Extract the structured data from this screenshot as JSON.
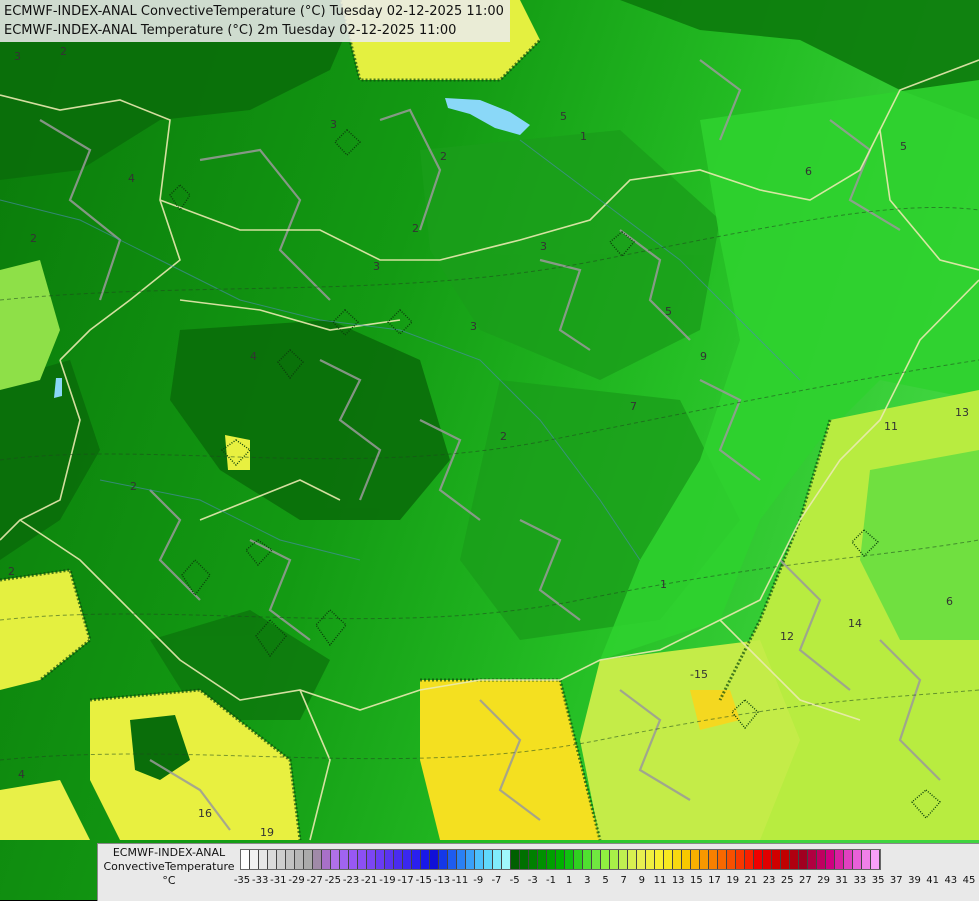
{
  "title": {
    "line1": "ECMWF-INDEX-ANAL ConvectiveTemperature (°C) Tuesday 02-12-2025 11:00",
    "line2": "ECMWF-INDEX-ANAL Temperature (°C) 2m Tuesday 02-12-2025 11:00"
  },
  "legend": {
    "line1": "ECMWF-INDEX-ANAL",
    "line2": "ConvectiveTemperature",
    "unit": "°C",
    "tick_labels": [
      "-35",
      "-33",
      "-31",
      "-29",
      "-27",
      "-25",
      "-23",
      "-21",
      "-19",
      "-17",
      "-15",
      "-13",
      "-11",
      "-9",
      "-7",
      "-5",
      "-3",
      "-1",
      "1",
      "3",
      "5",
      "7",
      "9",
      "11",
      "13",
      "15",
      "17",
      "19",
      "21",
      "23",
      "25",
      "27",
      "29",
      "31",
      "33",
      "35",
      "37",
      "39",
      "41",
      "43",
      "45"
    ],
    "colors": [
      "#ffffff",
      "#f2f2f2",
      "#e6e6e6",
      "#dadada",
      "#cecece",
      "#c2c2c2",
      "#b6b6b6",
      "#aaaaaa",
      "#a08aa8",
      "#a870c8",
      "#b070e8",
      "#a064f0",
      "#9858f4",
      "#8c50f4",
      "#7c46f4",
      "#6a3cf4",
      "#5a34f0",
      "#4a2cf0",
      "#3a28f0",
      "#2a20ee",
      "#1818e8",
      "#1010d8",
      "#1438e8",
      "#1e5cf0",
      "#2a80f4",
      "#3aa0f8",
      "#4cc0fc",
      "#60d8fc",
      "#80ecfc",
      "#a0f8fc",
      "#006000",
      "#007000",
      "#008000",
      "#009000",
      "#00a000",
      "#00b000",
      "#10c010",
      "#30d020",
      "#50e030",
      "#70e840",
      "#90f040",
      "#a8f048",
      "#c0f050",
      "#d8f050",
      "#e8f050",
      "#f0f040",
      "#f8f030",
      "#f8e820",
      "#f8d810",
      "#f8c800",
      "#f8b000",
      "#f89800",
      "#f88000",
      "#f86800",
      "#f85000",
      "#f83800",
      "#f82000",
      "#f00000",
      "#e00000",
      "#d00000",
      "#c00000",
      "#b00010",
      "#a00020",
      "#b00040",
      "#c00060",
      "#d00080",
      "#d820a0",
      "#e040c0",
      "#e860d8",
      "#f080e8",
      "#f8a0f8"
    ]
  },
  "map_labels": [
    "3",
    "2",
    "4",
    "2",
    "3",
    "2",
    "5",
    "6",
    "5",
    "3",
    "3",
    "1",
    "2",
    "2",
    "4",
    "2",
    "13",
    "11",
    "14",
    "-15",
    "16",
    "19",
    "6",
    "3",
    "4",
    "7",
    "9",
    "12",
    "2",
    "5",
    "1"
  ]
}
